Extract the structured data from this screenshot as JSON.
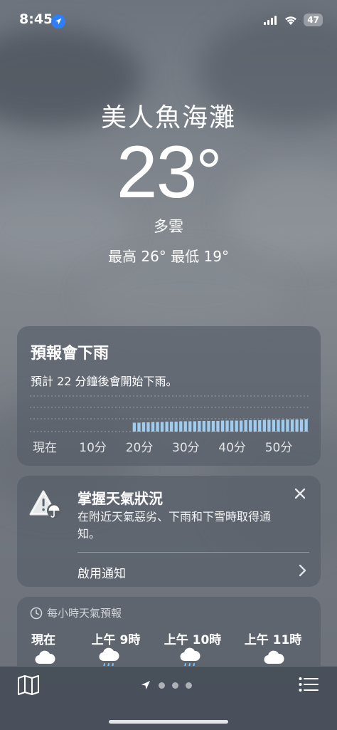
{
  "status_bar": {
    "time": "8:45",
    "battery": "47"
  },
  "header": {
    "location": "美人魚海灘",
    "temperature": "23",
    "degree_symbol": "°",
    "condition": "多雲",
    "high_low": "最高 26°  最低 19°"
  },
  "rain_card": {
    "title": "預報會下雨",
    "description": "預計 22 分鐘後會開始下雨。",
    "x_labels": [
      "現在",
      "10分",
      "20分",
      "30分",
      "40分",
      "50分"
    ],
    "bar_color": "#9fcdf0"
  },
  "chart_data": {
    "type": "bar",
    "title": "預報會下雨",
    "x": [
      0,
      1,
      2,
      3,
      4,
      5,
      6,
      7,
      8,
      9,
      10,
      11,
      12,
      13,
      14,
      15,
      16,
      17,
      18,
      19,
      20,
      21,
      22,
      23,
      24,
      25,
      26,
      27,
      28,
      29,
      30,
      31,
      32,
      33,
      34,
      35,
      36,
      37,
      38,
      39,
      40,
      41,
      42,
      43,
      44,
      45,
      46,
      47,
      48,
      49,
      50,
      51,
      52,
      53,
      54,
      55,
      56,
      57,
      58,
      59
    ],
    "values": [
      0,
      0,
      0,
      0,
      0,
      0,
      0,
      0,
      0,
      0,
      0,
      0,
      0,
      0,
      0,
      0,
      0,
      0,
      0,
      0,
      0,
      0,
      0.25,
      0.25,
      0.26,
      0.26,
      0.27,
      0.27,
      0.27,
      0.28,
      0.28,
      0.28,
      0.29,
      0.29,
      0.29,
      0.29,
      0.3,
      0.3,
      0.3,
      0.3,
      0.3,
      0.31,
      0.31,
      0.31,
      0.31,
      0.31,
      0.32,
      0.32,
      0.32,
      0.32,
      0.33,
      0.33,
      0.33,
      0.33,
      0.33,
      0.34,
      0.34,
      0.34,
      0.34,
      0.35
    ],
    "x_tick_labels": [
      "現在",
      "10分",
      "20分",
      "30分",
      "40分",
      "50分"
    ],
    "ylim": [
      0,
      1
    ],
    "grid": true
  },
  "alert_card": {
    "title": "掌握天氣狀況",
    "body": "在附近天氣惡劣、下雨和下雪時取得通知。",
    "action": "啟用通知"
  },
  "hourly_card": {
    "header": "每小時天氣預報",
    "hours": [
      {
        "time": "現在",
        "icon": "cloud-icon"
      },
      {
        "time": "上午 9時",
        "icon": "cloud-rain-icon"
      },
      {
        "time": "上午 10時",
        "icon": "cloud-rain-icon"
      },
      {
        "time": "上午 11時",
        "icon": "cloud-icon"
      }
    ]
  },
  "bottom_bar": {
    "icons": [
      "map-icon",
      "location-arrow-icon",
      "list-icon"
    ],
    "pages": 3
  }
}
